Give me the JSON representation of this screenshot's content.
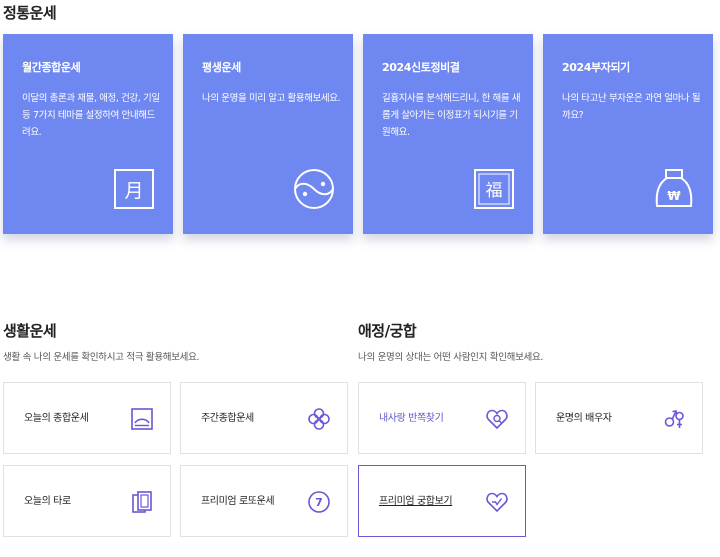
{
  "top_section": {
    "title": "정통운세",
    "cards": [
      {
        "title": "월간종합운세",
        "desc": "이달의 총론과 재물, 애정, 건강, 기일 등 7가지 테마를 설정하여 안내해드려요.",
        "icon": "moon-calendar-icon",
        "icon_text": "月"
      },
      {
        "title": "평생운세",
        "desc": "나의 운명을 미리 알고 활용해보세요.",
        "icon": "yin-yang-icon"
      },
      {
        "title": "2024신토정비결",
        "desc": "길흉지사를 분석해드리니, 한 해를 새롭게 살아가는 이정표가 되시기를 기원해요.",
        "icon": "fortune-stamp-icon",
        "icon_text": "福"
      },
      {
        "title": "2024부자되기",
        "desc": "나의 타고난 부자운은 과연 얼마나 될까요?",
        "icon": "money-bag-icon",
        "icon_text": "₩"
      }
    ]
  },
  "life_section": {
    "title": "생활운세",
    "desc": "생활 속 나의 운세를 확인하시고 적극 활용해보세요.",
    "items": [
      {
        "label": "오늘의 종합운세",
        "icon": "sunrise-frame-icon"
      },
      {
        "label": "주간종합운세",
        "icon": "clover-icon"
      },
      {
        "label": "오늘의 타로",
        "icon": "tarot-cards-icon"
      },
      {
        "label": "프리미엄 로또운세",
        "icon": "lotto-ball-icon",
        "icon_text": "7"
      }
    ]
  },
  "love_section": {
    "title": "애정/궁합",
    "desc": "나의 운명의 상대는 어떤 사람인지 확인해보세요.",
    "items": [
      {
        "label": "내사랑 반쪽찾기",
        "icon": "heart-search-icon"
      },
      {
        "label": "운명의 배우자",
        "icon": "gender-symbols-icon"
      },
      {
        "label": "프리미엄 궁합보기",
        "icon": "heart-link-icon"
      }
    ]
  },
  "colors": {
    "card_bg": "#6f87f0",
    "accent": "#6b57d6",
    "icon_color": "#6b57d6"
  }
}
